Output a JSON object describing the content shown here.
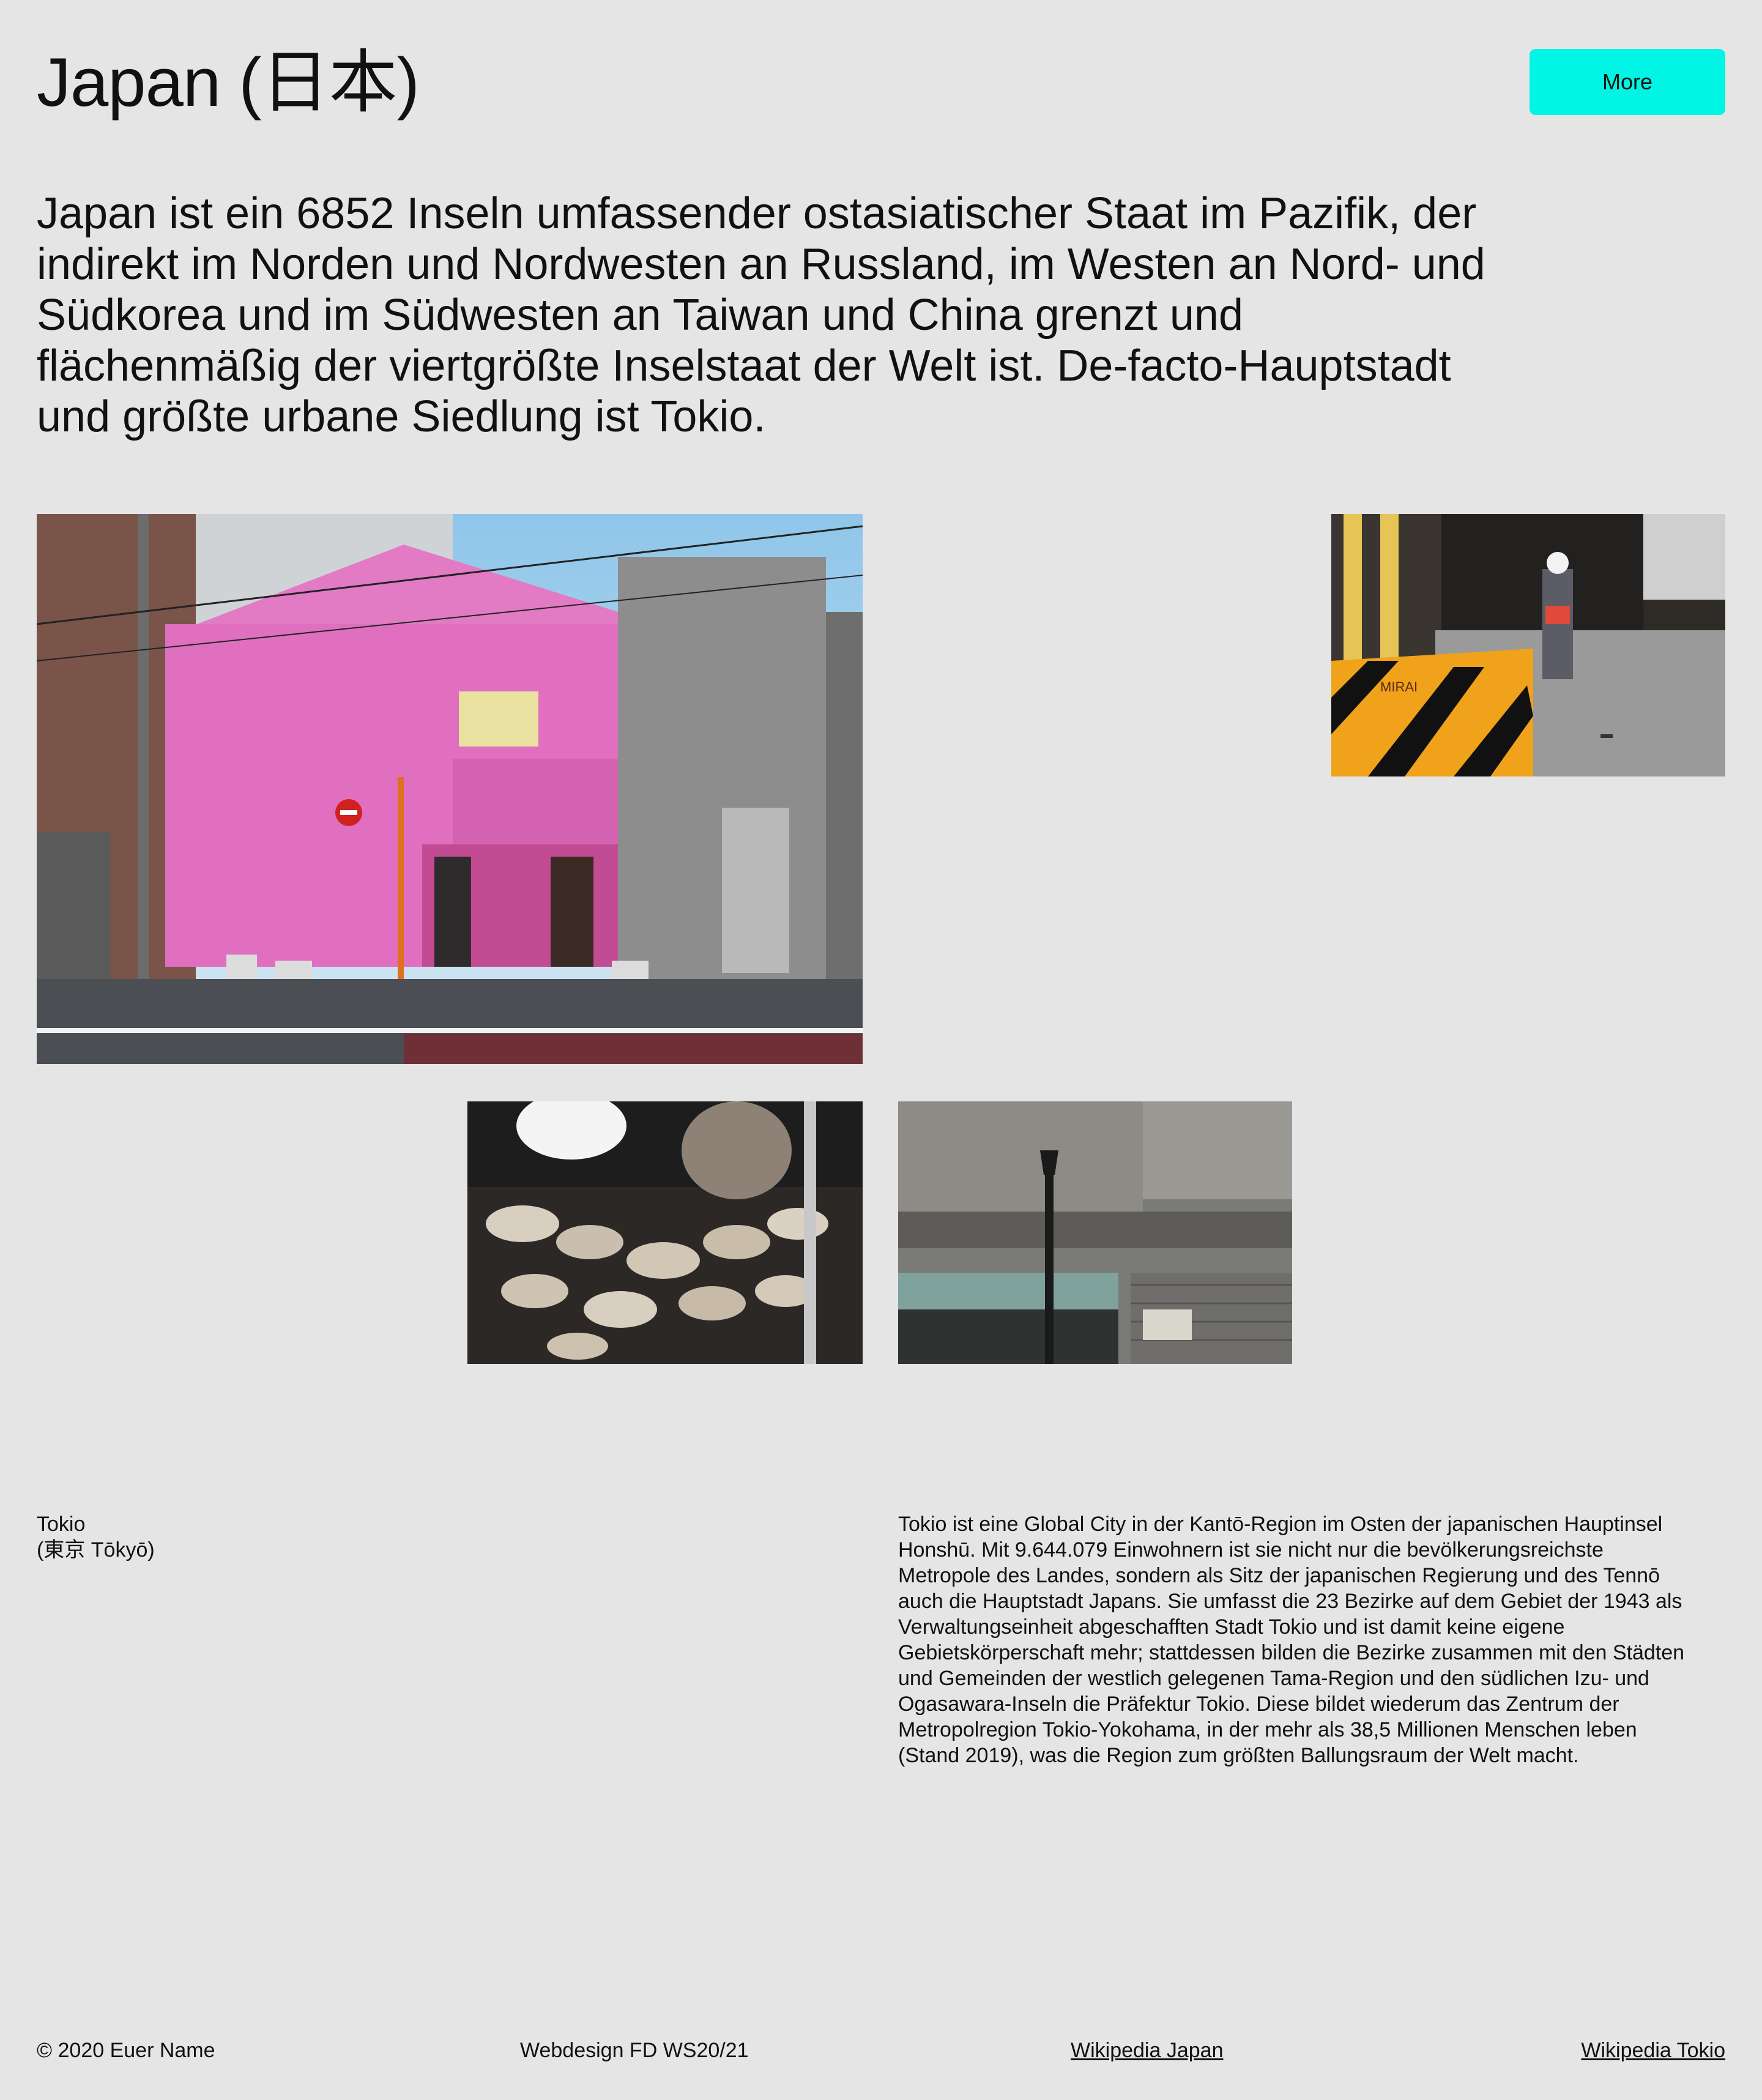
{
  "header": {
    "title": "Japan (日本)",
    "more_label": "More"
  },
  "intro": {
    "text": "Japan ist ein 6852 Inseln umfassender ostasiatischer Staat im Pazifik, der indirekt im Norden und Nordwesten an Russland, im Westen an Nord- und Südkorea und im Südwesten an Taiwan und China grenzt und flächenmäßig der viertgrößte Inselstaat der Welt ist. De-facto-Hauptstadt und größte urbane Siedlung ist Tokio."
  },
  "photos": {
    "worker_sign_text": "MIRAI"
  },
  "tokio": {
    "name_line1": "Tokio",
    "name_line2": "(東京 Tōkyō)",
    "description": "Tokio ist eine Global City in der Kantō-Region im Osten der japanischen Hauptinsel Honshū. Mit 9.644.079 Einwohnern ist sie nicht nur die bevölkerungsreichste Metropole des Landes, sondern als Sitz der japanischen Regierung und des Tennō auch die Hauptstadt Japans. Sie umfasst die 23 Bezirke auf dem Gebiet der 1943 als Verwaltungseinheit abgeschafften Stadt Tokio und ist damit keine eigene Gebietskörperschaft mehr; stattdessen bilden die Bezirke zusammen mit den Städten und Gemeinden der westlich gelegenen Tama-Region und den südlichen Izu- und Ogasawara-Inseln die Präfektur Tokio. Diese bildet wiederum das Zentrum der Metropolregion Tokio-Yokohama, in der mehr als 38,5 Millionen Menschen leben (Stand 2019), was die Region zum größten Ballungsraum der Welt macht."
  },
  "footer": {
    "copyright": "© 2020 Euer Name",
    "course": "Webdesign FD WS20/21",
    "link_japan": "Wikipedia Japan",
    "link_tokio": "Wikipedia Tokio"
  },
  "colors": {
    "background": "#e5e5e5",
    "accent_button": "#00f5e4",
    "text": "#111111"
  }
}
